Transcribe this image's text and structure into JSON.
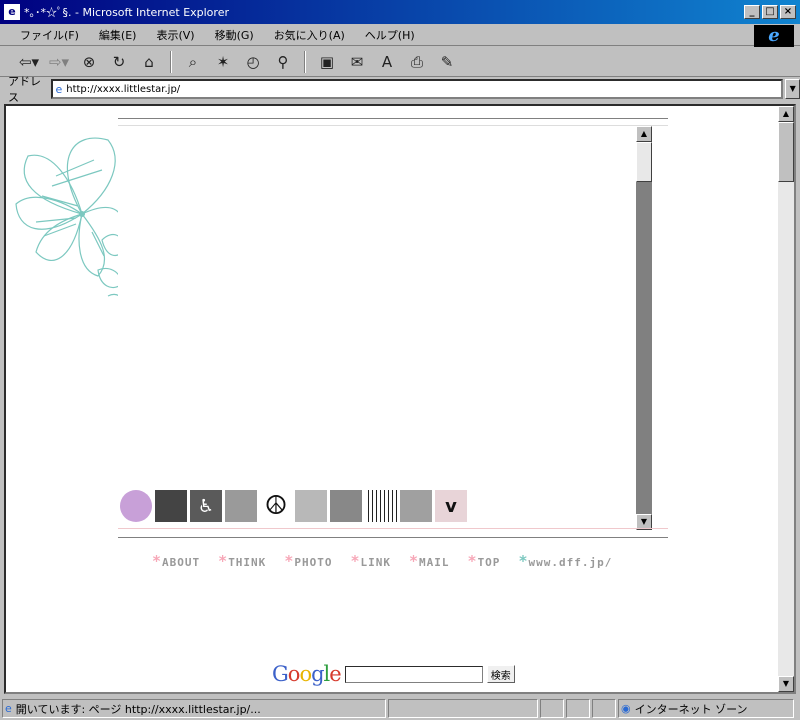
{
  "window": {
    "title": "*｡･*☆ﾟ§. - Microsoft Internet Explorer",
    "buttons": {
      "minimize": "_",
      "maximize": "□",
      "close": "×"
    }
  },
  "menubar": {
    "items": [
      "ファイル(F)",
      "編集(E)",
      "表示(V)",
      "移動(G)",
      "お気に入り(A)",
      "ヘルプ(H)"
    ]
  },
  "toolbar": {
    "buttons": [
      {
        "icon": "back-arrow-icon",
        "glyph": "⇦▾"
      },
      {
        "icon": "forward-arrow-icon",
        "glyph": "⇨▾"
      },
      {
        "icon": "stop-icon",
        "glyph": "⊗"
      },
      {
        "icon": "refresh-icon",
        "glyph": "↻"
      },
      {
        "icon": "home-icon",
        "glyph": "⌂"
      },
      {
        "icon": "search-icon",
        "glyph": "⌕"
      },
      {
        "icon": "favorites-icon",
        "glyph": "✶"
      },
      {
        "icon": "history-icon",
        "glyph": "◴"
      },
      {
        "icon": "channels-icon",
        "glyph": "⚲"
      },
      {
        "icon": "fullscreen-icon",
        "glyph": "▣"
      },
      {
        "icon": "mail-icon",
        "glyph": "✉"
      },
      {
        "icon": "font-icon",
        "glyph": "A"
      },
      {
        "icon": "print-icon",
        "glyph": "⎙"
      },
      {
        "icon": "edit-icon",
        "glyph": "✎"
      }
    ]
  },
  "address": {
    "label": "アドレス",
    "url": "http://xxxx.littlestar.jp/"
  },
  "page": {
    "nav": [
      {
        "star": "*",
        "label": "ABOUT"
      },
      {
        "star": "*",
        "label": "THINK"
      },
      {
        "star": "*",
        "label": "PHOTO"
      },
      {
        "star": "*",
        "label": "LINK"
      },
      {
        "star": "*",
        "label": "MAIL"
      },
      {
        "star": "*",
        "label": "TOP"
      },
      {
        "star": "*",
        "label": "www.dff.jp/"
      }
    ],
    "icons": [
      {
        "name": "apple-icon",
        "glyph": "",
        "bg": "#c8a0d8"
      },
      {
        "name": "trash-can-icon",
        "glyph": "",
        "bg": "#444444"
      },
      {
        "name": "wheelchair-icon",
        "glyph": "♿",
        "bg": "#5a5a5a"
      },
      {
        "name": "flower-photo-icon",
        "glyph": "",
        "bg": "#9a9a9a"
      },
      {
        "name": "peace-sign-icon",
        "glyph": "☮",
        "bg": "#ffffff"
      },
      {
        "name": "bear-icon",
        "glyph": "",
        "bg": "#b8b8b8"
      },
      {
        "name": "blossom-photo-icon",
        "glyph": "",
        "bg": "#888888"
      },
      {
        "name": "piano-keys-icon",
        "glyph": "",
        "bg": "#ffffff"
      },
      {
        "name": "teddy-bear-icon",
        "glyph": "",
        "bg": "#a0a0a0"
      },
      {
        "name": "checkmark-icon",
        "glyph": "v",
        "bg": "#e8d4d8"
      }
    ],
    "google": {
      "logo": "Google",
      "button": "検索"
    }
  },
  "status": {
    "text": "開いています: ページ http://xxxx.littlestar.jp/...",
    "zone": "インターネット ゾーン"
  },
  "colors": {
    "star_pink": "#f7a8b8",
    "star_teal": "#7cc8c0",
    "flower_line": "#7cc8c0"
  }
}
